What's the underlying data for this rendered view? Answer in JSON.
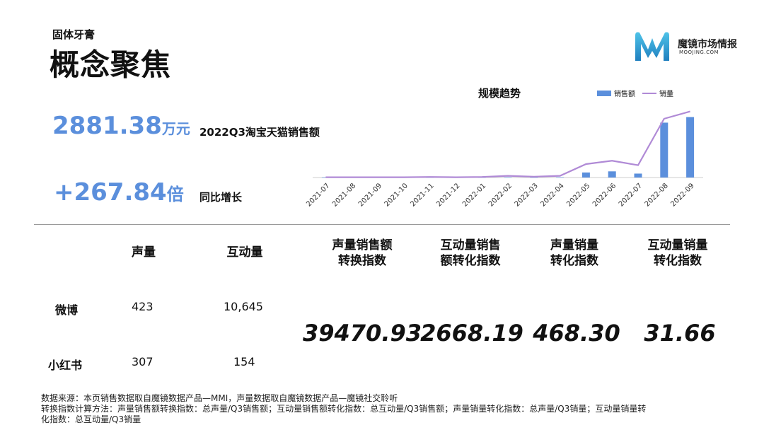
{
  "header": {
    "subtitle": "固体牙膏",
    "title": "概念聚焦"
  },
  "logo": {
    "name": "魔镜市场情报",
    "sub": "MOOJING.COM"
  },
  "kpis": {
    "sales_value": "2881.38",
    "sales_unit": "万元",
    "sales_label": "2022Q3淘宝天猫销售额",
    "growth_value": "+267.84",
    "growth_unit": "倍",
    "growth_label": "同比增长"
  },
  "chart_data": {
    "type": "bar",
    "title": "规模趋势",
    "categories": [
      "2021-07",
      "2021-08",
      "2021-09",
      "2021-10",
      "2021-11",
      "2021-12",
      "2022-01",
      "2022-02",
      "2022-03",
      "2022-04",
      "2022-05",
      "2022-06",
      "2022-07",
      "2022-08",
      "2022-09"
    ],
    "series": [
      {
        "name": "销售额",
        "kind": "bar",
        "values": [
          0.3,
          0.3,
          0.3,
          0.3,
          0.4,
          0.3,
          0.4,
          0.6,
          0.4,
          0.6,
          9,
          11,
          7,
          98,
          108
        ],
        "color": "#5b8fdc"
      },
      {
        "name": "销量",
        "kind": "line",
        "values": [
          0.5,
          0.5,
          0.5,
          0.5,
          1,
          0.5,
          1,
          3,
          1.5,
          3,
          24,
          30,
          22,
          105,
          118
        ],
        "color": "#b08ad6"
      }
    ],
    "legend_position": "top-right",
    "grid": false
  },
  "table": {
    "headers": [
      "声量",
      "互动量"
    ],
    "index_headers": [
      [
        "声量销售额",
        "转换指数"
      ],
      [
        "互动量销售",
        "额转化指数"
      ],
      [
        "声量销量",
        "转化指数"
      ],
      [
        "互动量销量",
        "转化指数"
      ]
    ],
    "rows": [
      {
        "platform": "微博",
        "volume": "423",
        "interaction": "10,645"
      },
      {
        "platform": "小红书",
        "volume": "307",
        "interaction": "154"
      }
    ],
    "index_values": [
      "39470.93",
      "2668.19",
      "468.30",
      "31.66"
    ]
  },
  "footer": {
    "line1": "数据来源：本页销售数据取自魔镜数据产品—MMI，声量数据取自魔镜数据产品—魔镜社交聆听",
    "line2": "转换指数计算方法：声量销售额转换指数：总声量/Q3销售额；互动量销售额转化指数：总互动量/Q3销售额；声量销量转化指数：总声量/Q3销量；互动量销量转",
    "line3": "化指数：总互动量/Q3销量"
  },
  "colors": {
    "accent": "#5b8fdc",
    "line": "#b08ad6",
    "logo_dark": "#1f7fbf",
    "logo_light": "#4fc3e8"
  }
}
